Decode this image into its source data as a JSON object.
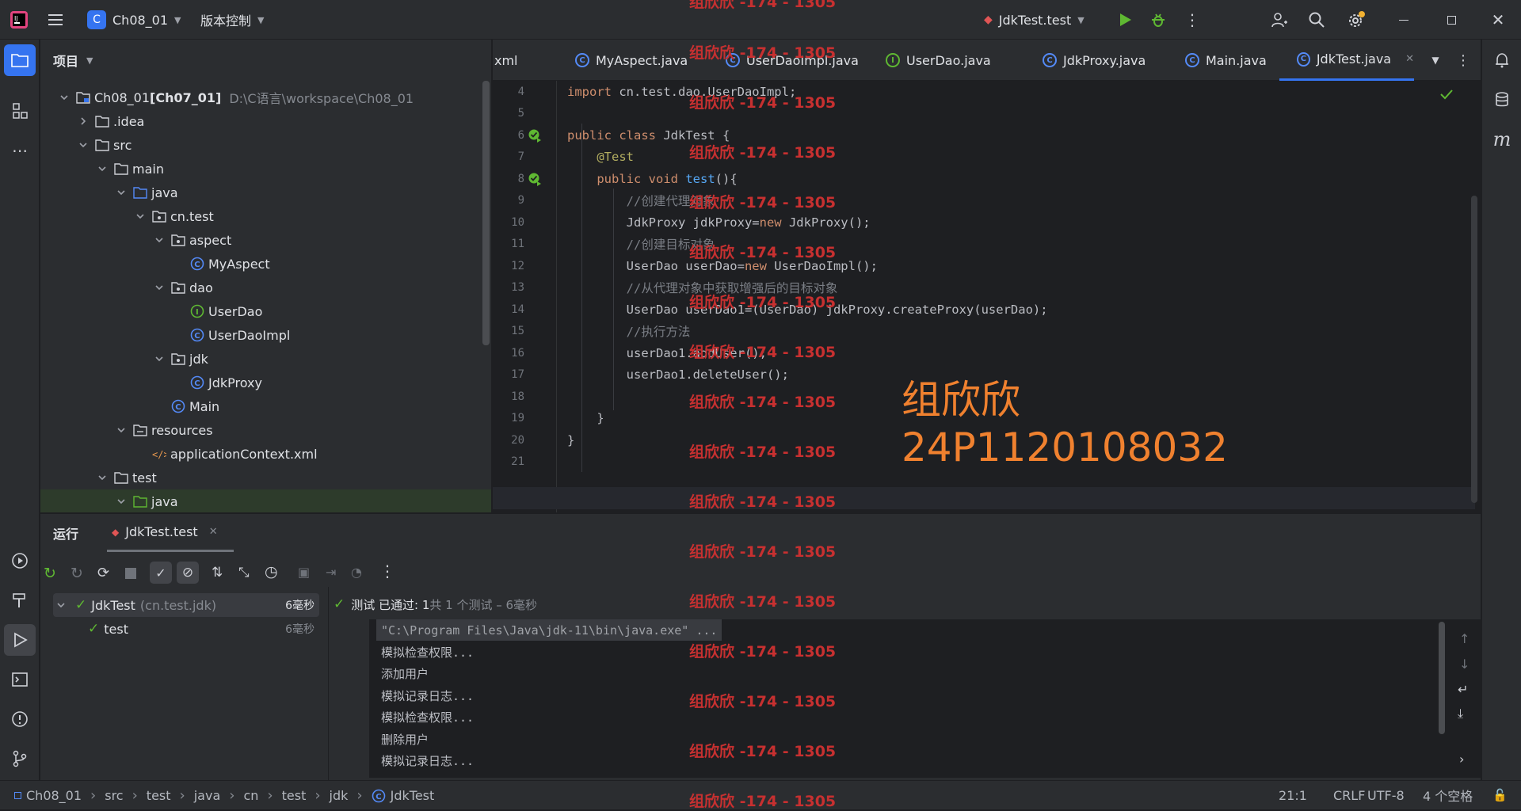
{
  "titlebar": {
    "project_badge": "C",
    "project_name": "Ch08_01",
    "vcs_label": "版本控制",
    "run_config": "JdkTest.test"
  },
  "project_panel": {
    "title": "项目",
    "tree": [
      {
        "label": "Ch08_01",
        "extra": "[Ch07_01]",
        "path": "D:\\C语言\\workspace\\Ch08_01",
        "type": "module",
        "depth": 0,
        "expanded": true
      },
      {
        "label": ".idea",
        "type": "folder",
        "depth": 1,
        "expanded": false
      },
      {
        "label": "src",
        "type": "folder",
        "depth": 1,
        "expanded": true
      },
      {
        "label": "main",
        "type": "folder",
        "depth": 2,
        "expanded": true
      },
      {
        "label": "java",
        "type": "src-folder",
        "depth": 3,
        "expanded": true
      },
      {
        "label": "cn.test",
        "type": "package",
        "depth": 4,
        "expanded": true
      },
      {
        "label": "aspect",
        "type": "package",
        "depth": 5,
        "expanded": true
      },
      {
        "label": "MyAspect",
        "type": "class",
        "depth": 6
      },
      {
        "label": "dao",
        "type": "package",
        "depth": 5,
        "expanded": true
      },
      {
        "label": "UserDao",
        "type": "interface",
        "depth": 6
      },
      {
        "label": "UserDaoImpl",
        "type": "class",
        "depth": 6
      },
      {
        "label": "jdk",
        "type": "package",
        "depth": 5,
        "expanded": true
      },
      {
        "label": "JdkProxy",
        "type": "class",
        "depth": 6
      },
      {
        "label": "Main",
        "type": "class",
        "depth": 5
      },
      {
        "label": "resources",
        "type": "res-folder",
        "depth": 3,
        "expanded": true
      },
      {
        "label": "applicationContext.xml",
        "type": "xml",
        "depth": 4
      },
      {
        "label": "test",
        "type": "folder",
        "depth": 2,
        "expanded": true
      },
      {
        "label": "java",
        "type": "test-folder",
        "depth": 3,
        "expanded": true
      }
    ]
  },
  "editor": {
    "tabs": [
      {
        "label": "xml",
        "icon": "none"
      },
      {
        "label": "MyAspect.java",
        "icon": "class"
      },
      {
        "label": "UserDaoImpl.java",
        "icon": "class"
      },
      {
        "label": "UserDao.java",
        "icon": "interface"
      },
      {
        "label": "JdkProxy.java",
        "icon": "class"
      },
      {
        "label": "Main.java",
        "icon": "class"
      },
      {
        "label": "JdkTest.java",
        "icon": "class",
        "active": true
      }
    ],
    "lines": [
      {
        "n": "4",
        "html": "<span class='kw'>import</span> cn.test.dao.UserDaoImpl;"
      },
      {
        "n": "5",
        "html": ""
      },
      {
        "n": "6",
        "html": "<span class='kw'>public class</span> JdkTest {",
        "gutter": true
      },
      {
        "n": "7",
        "html": "    <span class='an'>@Test</span>"
      },
      {
        "n": "8",
        "html": "    <span class='kw'>public void</span> <span class='fn'>test</span>(){",
        "gutter": true
      },
      {
        "n": "9",
        "html": "        <span class='cm'>//创建代理对象</span>"
      },
      {
        "n": "10",
        "html": "        JdkProxy jdkProxy=<span class='kw'>new</span> JdkProxy();"
      },
      {
        "n": "11",
        "html": "        <span class='cm'>//创建目标对象</span>"
      },
      {
        "n": "12",
        "html": "        UserDao userDao=<span class='kw'>new</span> UserDaoImpl();"
      },
      {
        "n": "13",
        "html": "        <span class='cm'>//从代理对象中获取增强后的目标对象</span>"
      },
      {
        "n": "14",
        "html": "        UserDao userDao1=(UserDao) jdkProxy.createProxy(userDao);"
      },
      {
        "n": "15",
        "html": "        <span class='cm'>//执行方法</span>"
      },
      {
        "n": "16",
        "html": "        userDao1.addUser();"
      },
      {
        "n": "17",
        "html": "        userDao1.deleteUser();"
      },
      {
        "n": "18",
        "html": ""
      },
      {
        "n": "19",
        "html": "    }"
      },
      {
        "n": "20",
        "html": "}"
      },
      {
        "n": "21",
        "html": ""
      }
    ],
    "overlay_name": "组欣欣",
    "overlay_id": "24P1120108032"
  },
  "run_panel": {
    "title": "运行",
    "tab_label": "JdkTest.test",
    "tests": [
      {
        "name": "JdkTest",
        "pkg": "(cn.test.jdk)",
        "time": "6毫秒",
        "depth": 0
      },
      {
        "name": "test",
        "pkg": "",
        "time": "6毫秒",
        "depth": 1
      }
    ],
    "status_prefix": "测试 已通过: 1",
    "status_suffix": "共 1 个测试 – 6毫秒",
    "console": [
      "\"C:\\Program Files\\Java\\jdk-11\\bin\\java.exe\" ...",
      "模拟检查权限...",
      "添加用户",
      "模拟记录日志...",
      "模拟检查权限...",
      "删除用户",
      "模拟记录日志..."
    ]
  },
  "statusbar": {
    "breadcrumbs": [
      "Ch08_01",
      "src",
      "test",
      "java",
      "cn",
      "test",
      "jdk",
      "JdkTest"
    ],
    "position": "21:1",
    "line_sep": "CRLF",
    "encoding": "UTF-8",
    "indent": "4 个空格"
  },
  "watermark": {
    "text": "组欣欣 -174 - 1305"
  },
  "colors": {
    "accent": "#3574f0",
    "success": "#5fb832",
    "overlay": "#f0812f",
    "watermark": "#c73030"
  }
}
